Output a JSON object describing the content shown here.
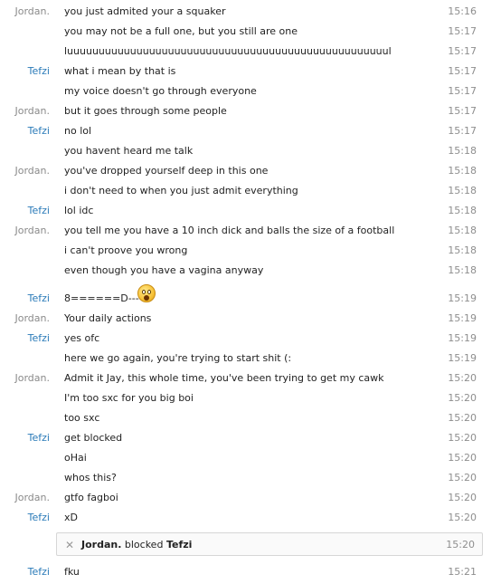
{
  "notice": {
    "actor": "Jordan.",
    "action": "blocked",
    "target": "Tefzi",
    "time": "15:20",
    "icon": "close-icon"
  },
  "messages": [
    {
      "sender": "Jordan.",
      "text": "you just admited your a squaker",
      "time": "15:16"
    },
    {
      "sender": "",
      "text": "you may not be a full one, but you still are one",
      "time": "15:17"
    },
    {
      "sender": "",
      "text": "luuuuuuuuuuuuuuuuuuuuuuuuuuuuuuuuuuuuuuuuuuuuuuuuuuul",
      "time": "15:17"
    },
    {
      "sender": "Tefzi",
      "text": "what i mean by that is",
      "time": "15:17"
    },
    {
      "sender": "",
      "text": "my voice doesn't go through everyone",
      "time": "15:17"
    },
    {
      "sender": "Jordan.",
      "text": "but it goes through some people",
      "time": "15:17"
    },
    {
      "sender": "Tefzi",
      "text": "no lol",
      "time": "15:17"
    },
    {
      "sender": "",
      "text": "you havent heard me talk",
      "time": "15:18"
    },
    {
      "sender": "Jordan.",
      "text": "you've dropped yourself deep in this one",
      "time": "15:18"
    },
    {
      "sender": "",
      "text": "i don't need to when you just admit everything",
      "time": "15:18"
    },
    {
      "sender": "Tefzi",
      "text": "lol idc",
      "time": "15:18"
    },
    {
      "sender": "Jordan.",
      "text": "you tell me you have a 10 inch dick and balls the size of a football",
      "time": "15:18"
    },
    {
      "sender": "",
      "text": "i can't proove you wrong",
      "time": "15:18"
    },
    {
      "sender": "",
      "text": "even though you have a vagina anyway",
      "time": "15:18"
    },
    {
      "sender": "Tefzi",
      "text": "8======D----",
      "time": "15:19",
      "emoji": "surprised-face-icon"
    },
    {
      "sender": "Jordan.",
      "text": "Your daily actions",
      "time": "15:19"
    },
    {
      "sender": "Tefzi",
      "text": "yes ofc",
      "time": "15:19"
    },
    {
      "sender": "",
      "text": "here we go again, you're trying to start shit (:",
      "time": "15:19"
    },
    {
      "sender": "Jordan.",
      "text": "Admit it Jay, this whole time, you've been trying to get my cawk",
      "time": "15:20"
    },
    {
      "sender": "",
      "text": "I'm too sxc for you big boi",
      "time": "15:20"
    },
    {
      "sender": "",
      "text": "too sxc",
      "time": "15:20"
    },
    {
      "sender": "Tefzi",
      "text": "get blocked",
      "time": "15:20"
    },
    {
      "sender": "",
      "text": "oHai",
      "time": "15:20"
    },
    {
      "sender": "",
      "text": "whos this?",
      "time": "15:20"
    },
    {
      "sender": "Jordan.",
      "text": "gtfo fagboi",
      "time": "15:20"
    },
    {
      "sender": "Tefzi",
      "text": "xD",
      "time": "15:20"
    },
    {
      "sender": "Tefzi",
      "text": "fku",
      "time": "15:21"
    }
  ],
  "colors": {
    "tefzi_name": "#2a7ab8",
    "jordan_name": "#8a8a8a",
    "timestamp": "#8e8e8e"
  }
}
